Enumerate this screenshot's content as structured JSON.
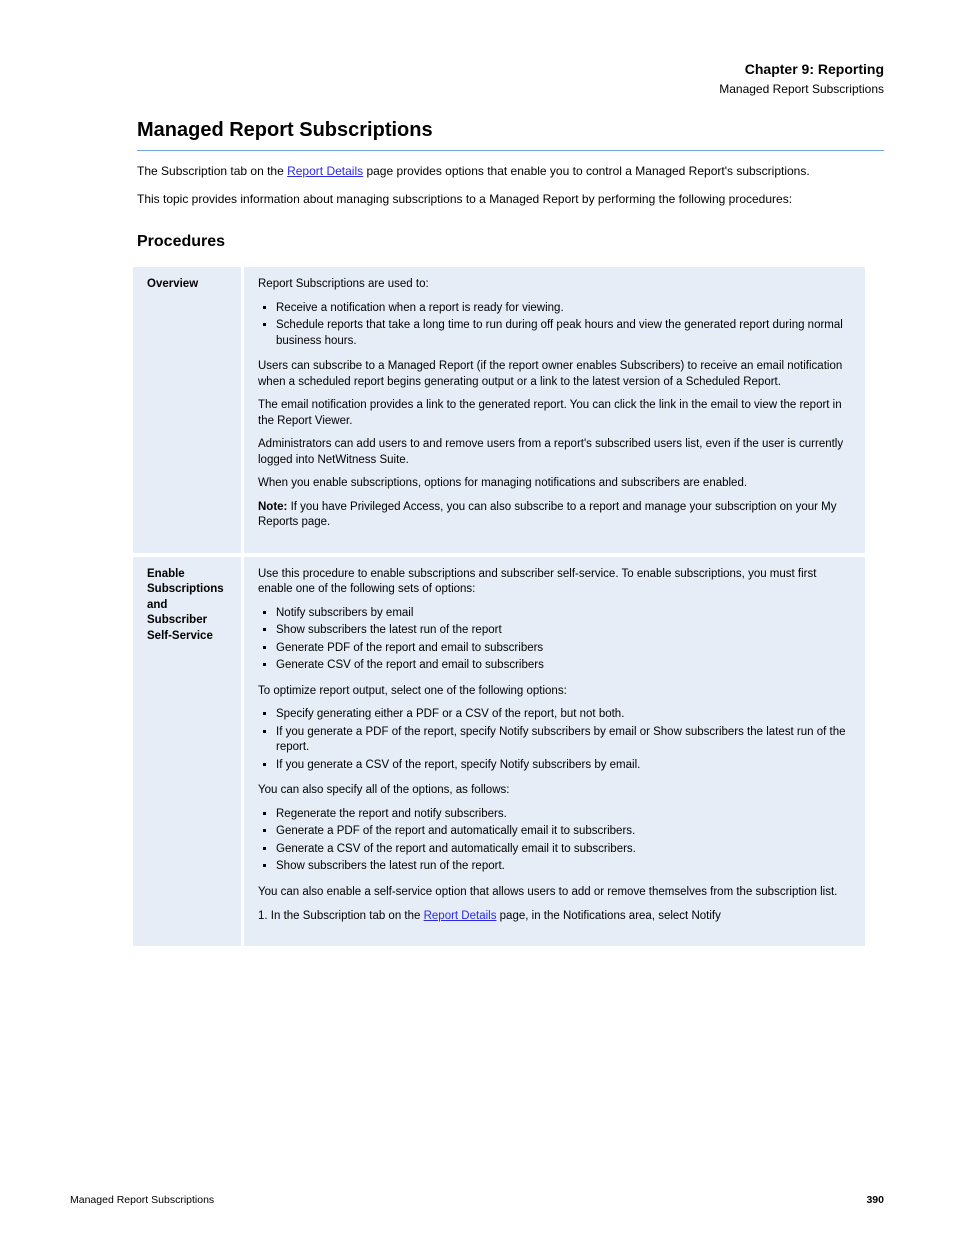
{
  "header": {
    "chapter": "Chapter 9: Reporting",
    "section": "Managed Report Subscriptions"
  },
  "title": "Managed Report Subscriptions",
  "intro": {
    "p1_prefix": "The Subscription tab on the ",
    "p1_link": "Report Details",
    "p1_suffix": " page provides options that enable you to control a Managed Report's subscriptions.",
    "p2": "This topic provides information about managing subscriptions to a Managed Report by performing the following procedures:"
  },
  "section_heading": "Procedures",
  "rows": [
    {
      "label": "Overview",
      "content": {
        "paragraphs": [
          "Report Subscriptions are used to:"
        ],
        "lists": [
          [
            "Receive a notification when a report is ready for viewing.",
            "Schedule reports that take a long time to run during off peak hours and view the generated report during normal business hours."
          ]
        ],
        "trailing_paragraphs": [
          "Users can subscribe to a Managed Report (if the report owner enables Subscribers) to receive an email notification when a scheduled report begins generating output or a link to the latest version of a Scheduled Report.",
          "The email notification provides a link to the generated report. You can click the link in the email to view the report in the Report Viewer.",
          "Administrators can add users to and remove users from a report's subscribed users list, even if the user is currently logged into NetWitness Suite.",
          "When you enable subscriptions, options for managing notifications and subscribers are enabled."
        ],
        "note": {
          "label": "Note: ",
          "text": "If you have Privileged Access, you can also subscribe to a report and manage your subscription on your My Reports page."
        }
      }
    },
    {
      "label": "Enable Subscriptions and Subscriber Self-Service",
      "content": {
        "paragraphs": [
          "Use this procedure to enable subscriptions and subscriber self-service. To enable subscriptions, you must first enable one of the following sets of options:"
        ],
        "lists": [
          [
            "Notify subscribers by email",
            "Show subscribers the latest run of the report",
            "Generate PDF of the report and email to subscribers",
            "Generate CSV of the report and email to subscribers"
          ]
        ],
        "mid_paragraphs": [
          "To optimize report output, select one of the following options:"
        ],
        "lists2": [
          [
            "Specify generating either a PDF or a CSV of the report, but not both.",
            "If you generate a PDF of the report, specify Notify subscribers by email or Show subscribers the latest run of the report.",
            "If you generate a CSV of the report, specify Notify subscribers by email."
          ]
        ],
        "mid_paragraphs2": [
          "You can also specify all of the options, as follows:"
        ],
        "lists3": [
          [
            "Regenerate the report and notify subscribers.",
            "Generate a PDF of the report and automatically email it to subscribers.",
            "Generate a CSV of the report and automatically email it to subscribers.",
            "Show subscribers the latest run of the report."
          ]
        ],
        "trailing_paragraphs": [
          "You can also enable a self-service option that allows users to add or remove themselves from the subscription list."
        ],
        "numbered": {
          "num": "1.",
          "prefix": "In the Subscription tab on the ",
          "link": "Report Details",
          "suffix": " page, in the Notifications area, select Notify"
        }
      }
    }
  ],
  "footer": {
    "left": "Managed Report Subscriptions",
    "right": "390"
  }
}
